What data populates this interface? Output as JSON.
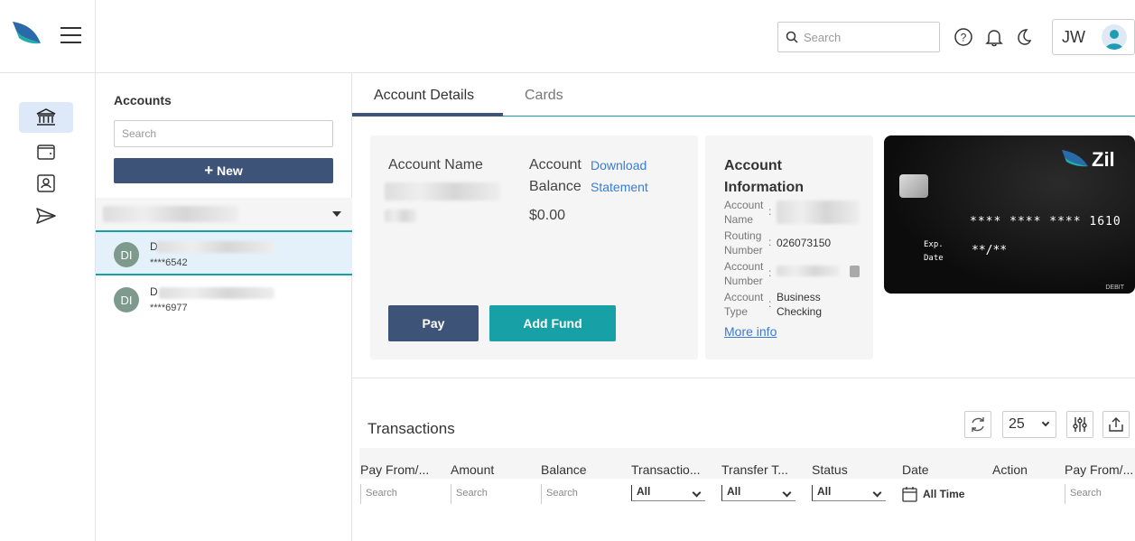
{
  "topbar": {
    "search_placeholder": "Search",
    "user_initials": "JW"
  },
  "accounts_panel": {
    "title": "Accounts",
    "search_placeholder": "Search",
    "new_label": "New",
    "items": [
      {
        "initials": "DI",
        "name": "D",
        "number": "****6542",
        "selected": true
      },
      {
        "initials": "DI",
        "name": "D",
        "number": "****6977",
        "selected": false
      }
    ]
  },
  "tabs": [
    {
      "label": "Account Details",
      "active": true
    },
    {
      "label": "Cards",
      "active": false
    }
  ],
  "account_summary": {
    "name_label": "Account Name",
    "balance_label_1": "Account",
    "balance_label_2": "Balance",
    "download_1": "Download",
    "download_2": "Statement",
    "balance_value": "$0.00",
    "pay_label": "Pay",
    "add_fund_label": "Add Fund"
  },
  "account_info": {
    "title": "Account Information",
    "rows": [
      {
        "key": "Account Name",
        "value": ""
      },
      {
        "key": "Routing Number",
        "value": "026073150"
      },
      {
        "key": "Account Number",
        "value": ""
      },
      {
        "key": "Account Type",
        "value": "Business Checking"
      }
    ],
    "more_info": "More info"
  },
  "debit_card": {
    "brand": "Zil",
    "number": "**** **** **** 1610",
    "exp_label_1": "Exp.",
    "exp_label_2": "Date",
    "exp_value": "**/**",
    "kind": "DEBIT"
  },
  "transactions": {
    "title": "Transactions",
    "page_size": "25",
    "columns": [
      {
        "label": "Pay From/...",
        "filter": "Search"
      },
      {
        "label": "Amount",
        "filter": "Search"
      },
      {
        "label": "Balance",
        "filter": "Search"
      },
      {
        "label": "Transactio...",
        "filter": "All"
      },
      {
        "label": "Transfer T...",
        "filter": "All"
      },
      {
        "label": "Status",
        "filter": "All"
      },
      {
        "label": "Date",
        "filter": "All Time"
      },
      {
        "label": "Action",
        "filter": ""
      },
      {
        "label": "Pay From/...",
        "filter": "Search"
      }
    ]
  },
  "colors": {
    "primary": "#3d5478",
    "accent": "#17a0a6",
    "link": "#3a7bd5"
  }
}
